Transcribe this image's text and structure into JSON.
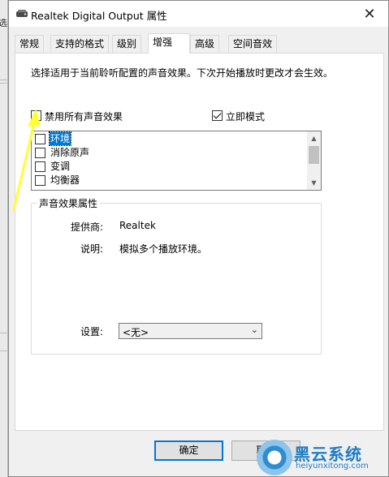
{
  "window": {
    "title": "Realtek Digital Output 属性",
    "title_icon": "speaker-icon",
    "close_label": "✕"
  },
  "background": {
    "char": "选"
  },
  "tabs": [
    {
      "label": "常规",
      "active": false
    },
    {
      "label": "支持的格式",
      "active": false
    },
    {
      "label": "级别",
      "active": false
    },
    {
      "label": "增强",
      "active": true
    },
    {
      "label": "高级",
      "active": false
    },
    {
      "label": "空间音效",
      "active": false
    }
  ],
  "enhancement": {
    "description": "选择适用于当前聆听配置的声音效果。下次开始播放时更改才会生效。",
    "disable_all": {
      "label": "禁用所有声音效果",
      "checked": false
    },
    "immediate_mode": {
      "label": "立即模式",
      "checked": true
    },
    "effects": [
      {
        "label": "环境",
        "checked": false,
        "selected": true
      },
      {
        "label": "消除原声",
        "checked": false,
        "selected": false
      },
      {
        "label": "变调",
        "checked": false,
        "selected": false
      },
      {
        "label": "均衡器",
        "checked": false,
        "selected": false
      }
    ],
    "properties": {
      "legend": "声音效果属性",
      "provider_label": "提供商:",
      "provider_value": "Realtek",
      "desc_label": "说明:",
      "desc_value": "模拟多个播放环境。",
      "settings_label": "设置:",
      "settings_value": "<无>"
    }
  },
  "buttons": {
    "ok": "确定",
    "cancel": "取消"
  },
  "watermark": {
    "main": "黑云系统",
    "sub": "heiyunxitong.com"
  },
  "colors": {
    "accent": "#0078d7",
    "annotation_arrow": "#ffff33",
    "watermark": "#1f7dc4"
  }
}
